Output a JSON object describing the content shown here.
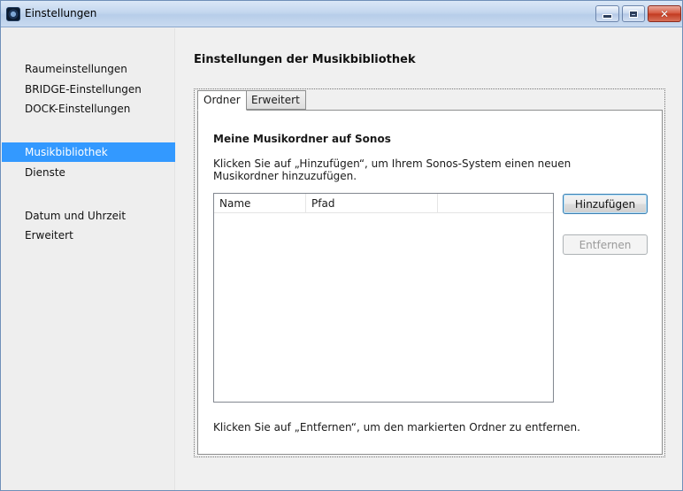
{
  "window": {
    "title": "Einstellungen",
    "close_glyph": "✕"
  },
  "sidebar": {
    "items": [
      {
        "label": "Raumeinstellungen"
      },
      {
        "label": "BRIDGE-Einstellungen"
      },
      {
        "label": "DOCK-Einstellungen"
      },
      {
        "label": "Musikbibliothek",
        "selected": true
      },
      {
        "label": "Dienste"
      },
      {
        "label": "Datum und Uhrzeit"
      },
      {
        "label": "Erweitert"
      }
    ]
  },
  "main": {
    "title": "Einstellungen der Musikbibliothek",
    "tabs": [
      {
        "label": "Ordner",
        "active": true
      },
      {
        "label": "Erweitert",
        "active": false
      }
    ],
    "section_title": "Meine Musikordner auf Sonos",
    "instruction": "Klicken Sie auf „Hinzufügen“, um Ihrem Sonos-System einen neuen Musikordner hinzuzufügen.",
    "list": {
      "columns": [
        "Name",
        "Pfad",
        ""
      ],
      "rows": []
    },
    "buttons": {
      "add": "Hinzufügen",
      "remove": "Entfernen"
    },
    "footer_note": "Klicken Sie auf „Entfernen“, um den markierten Ordner zu entfernen."
  },
  "colors": {
    "selection": "#3399ff",
    "titlebar": "#c3d6ee",
    "close_button": "#d4543a"
  }
}
